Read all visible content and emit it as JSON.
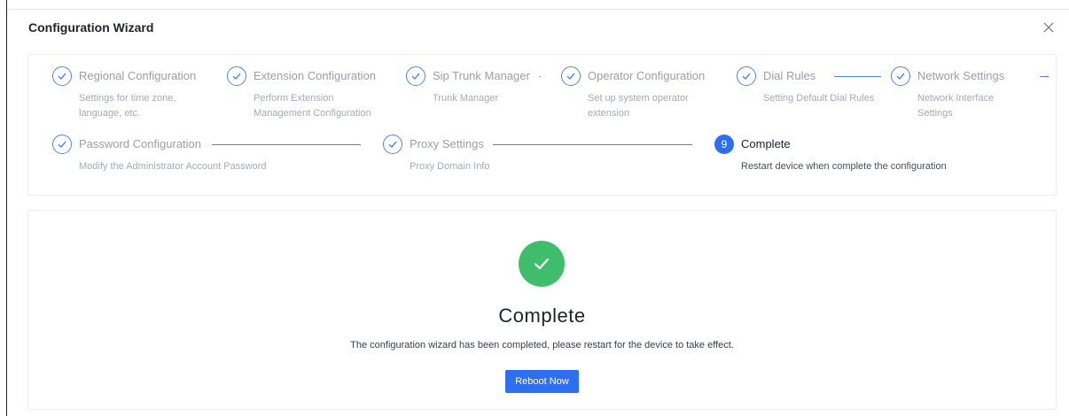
{
  "dialog": {
    "title": "Configuration Wizard",
    "close_icon": "close-icon"
  },
  "steps": [
    {
      "title": "Regional Configuration",
      "desc": "Settings for time zone, language, etc.",
      "status": "done"
    },
    {
      "title": "Extension Configuration",
      "desc": "Perform Extension Management Configuration",
      "status": "done"
    },
    {
      "title": "Sip Trunk Manager",
      "desc": "Trunk Manager",
      "status": "done"
    },
    {
      "title": "Operator Configuration",
      "desc": "Set up system operator extension",
      "status": "done"
    },
    {
      "title": "Dial Rules",
      "desc": "Setting Default Dial Rules",
      "status": "done"
    },
    {
      "title": "Network Settings",
      "desc": "Network Interface Settings",
      "status": "done"
    },
    {
      "title": "Password Configuration",
      "desc": "Modify the Administrator Account Password",
      "status": "done"
    },
    {
      "title": "Proxy Settings",
      "desc": "Proxy Domain Info",
      "status": "done"
    },
    {
      "title": "Complete",
      "desc": "Restart device when complete the configuration",
      "status": "active",
      "number": "9"
    }
  ],
  "result": {
    "icon": "check-circle-icon",
    "title": "Complete",
    "description": "The configuration wizard has been completed, please restart for the device to take effect.",
    "button_label": "Reboot Now"
  },
  "colors": {
    "primary": "#2d6ff2",
    "success": "#3fbd6b",
    "step_line": "#4e83f5"
  }
}
